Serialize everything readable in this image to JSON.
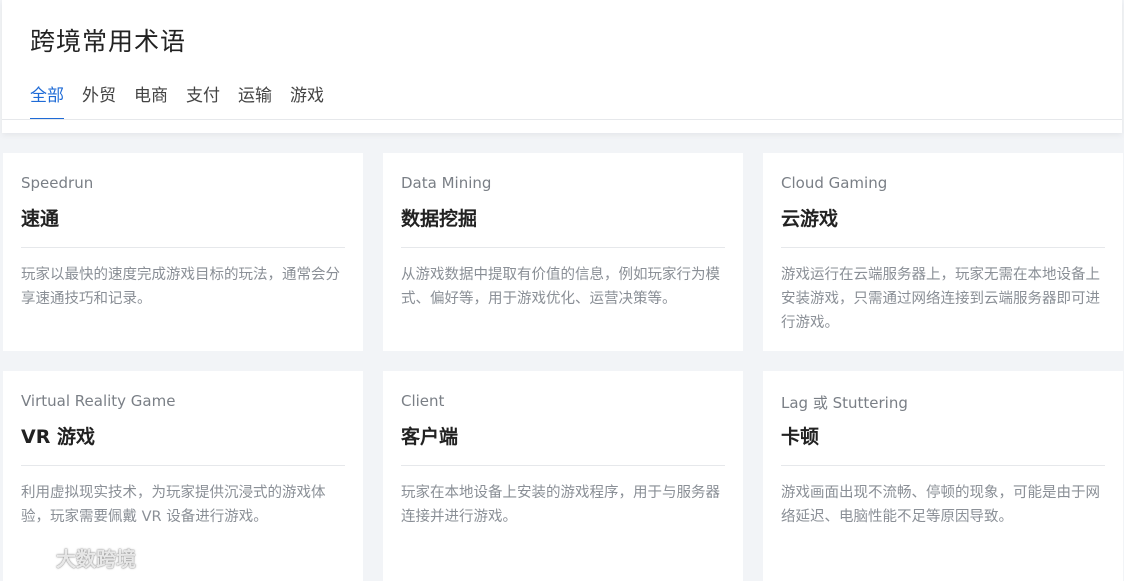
{
  "header": {
    "title": "跨境常用术语",
    "tabs": [
      {
        "label": "全部",
        "active": true
      },
      {
        "label": "外贸",
        "active": false
      },
      {
        "label": "电商",
        "active": false
      },
      {
        "label": "支付",
        "active": false
      },
      {
        "label": "运输",
        "active": false
      },
      {
        "label": "游戏",
        "active": false
      }
    ]
  },
  "cards": [
    {
      "en": "Speedrun",
      "zh": "速通",
      "desc": "玩家以最快的速度完成游戏目标的玩法，通常会分享速通技巧和记录。"
    },
    {
      "en": "Data Mining",
      "zh": "数据挖掘",
      "desc": "从游戏数据中提取有价值的信息，例如玩家行为模式、偏好等，用于游戏优化、运营决策等。"
    },
    {
      "en": "Cloud Gaming",
      "zh": "云游戏",
      "desc": "游戏运行在云端服务器上，玩家无需在本地设备上安装游戏，只需通过网络连接到云端服务器即可进行游戏。"
    },
    {
      "en": "Virtual Reality Game",
      "zh": "VR 游戏",
      "desc": "利用虚拟现实技术，为玩家提供沉浸式的游戏体验，玩家需要佩戴 VR 设备进行游戏。"
    },
    {
      "en": "Client",
      "zh": "客户端",
      "desc": "玩家在本地设备上安装的游戏程序，用于与服务器连接并进行游戏。"
    },
    {
      "en": "Lag 或 Stuttering",
      "zh": "卡顿",
      "desc": "游戏画面出现不流畅、停顿的现象，可能是由于网络延迟、电脑性能不足等原因导致。"
    }
  ],
  "watermark": {
    "text": "大数跨境"
  },
  "colors": {
    "accent": "#1f6bd6",
    "background": "#f2f4f7",
    "card": "#ffffff"
  }
}
